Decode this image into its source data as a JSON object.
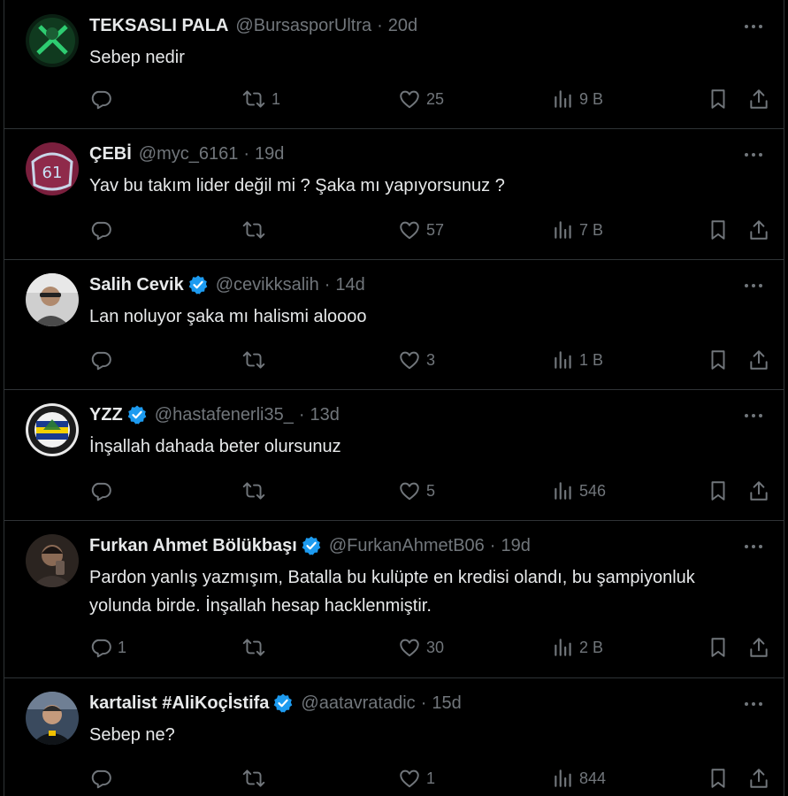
{
  "colors": {
    "background": "#000000",
    "divider": "#2f3336",
    "text_primary": "#e7e9ea",
    "text_secondary": "#71767b",
    "verified_blue": "#1d9bf0"
  },
  "icons": {
    "reply": "reply-icon",
    "retweet": "retweet-icon",
    "like": "heart-icon",
    "views": "views-icon",
    "bookmark": "bookmark-icon",
    "share": "share-icon",
    "more": "more-icon",
    "verified": "verified-badge-icon"
  },
  "tweets": [
    {
      "name": "TEKSASLI PALA",
      "verified": false,
      "handle": "@BursasporUltra",
      "separator": "·",
      "age": "20d",
      "text": "Sebep  nedir",
      "replies": "",
      "retweets": "1",
      "likes": "25",
      "views": "9 B"
    },
    {
      "name": "ÇEBİ",
      "verified": false,
      "handle": "@myc_6161",
      "separator": "·",
      "age": "19d",
      "text": "Yav bu takım lider değil mi ? Şaka mı yapıyorsunuz ?",
      "replies": "",
      "retweets": "",
      "likes": "57",
      "views": "7 B"
    },
    {
      "name": "Salih Cevik",
      "verified": true,
      "handle": "@cevikksalih",
      "separator": "·",
      "age": "14d",
      "text": "Lan noluyor şaka mı halismi aloooo",
      "replies": "",
      "retweets": "",
      "likes": "3",
      "views": "1 B"
    },
    {
      "name": "YZZ",
      "verified": true,
      "handle": "@hastafenerli35_",
      "separator": "·",
      "age": "13d",
      "text": "İnşallah dahada beter olursunuz",
      "replies": "",
      "retweets": "",
      "likes": "5",
      "views": "546"
    },
    {
      "name": "Furkan Ahmet Bölükbaşı",
      "verified": true,
      "handle": "@FurkanAhmetB06",
      "separator": "·",
      "age": "19d",
      "text": "Pardon yanlış yazmışım, Batalla bu kulüpte en kredisi olandı, bu şampiyonluk yolunda birde. İnşallah hesap hacklenmiştir.",
      "replies": "1",
      "retweets": "",
      "likes": "30",
      "views": "2 B"
    },
    {
      "name": "kartalist #AliKoçİstifa",
      "verified": true,
      "handle": "@aatavratadic",
      "separator": "·",
      "age": "15d",
      "text": "Sebep ne?",
      "replies": "",
      "retweets": "",
      "likes": "1",
      "views": "844"
    }
  ]
}
